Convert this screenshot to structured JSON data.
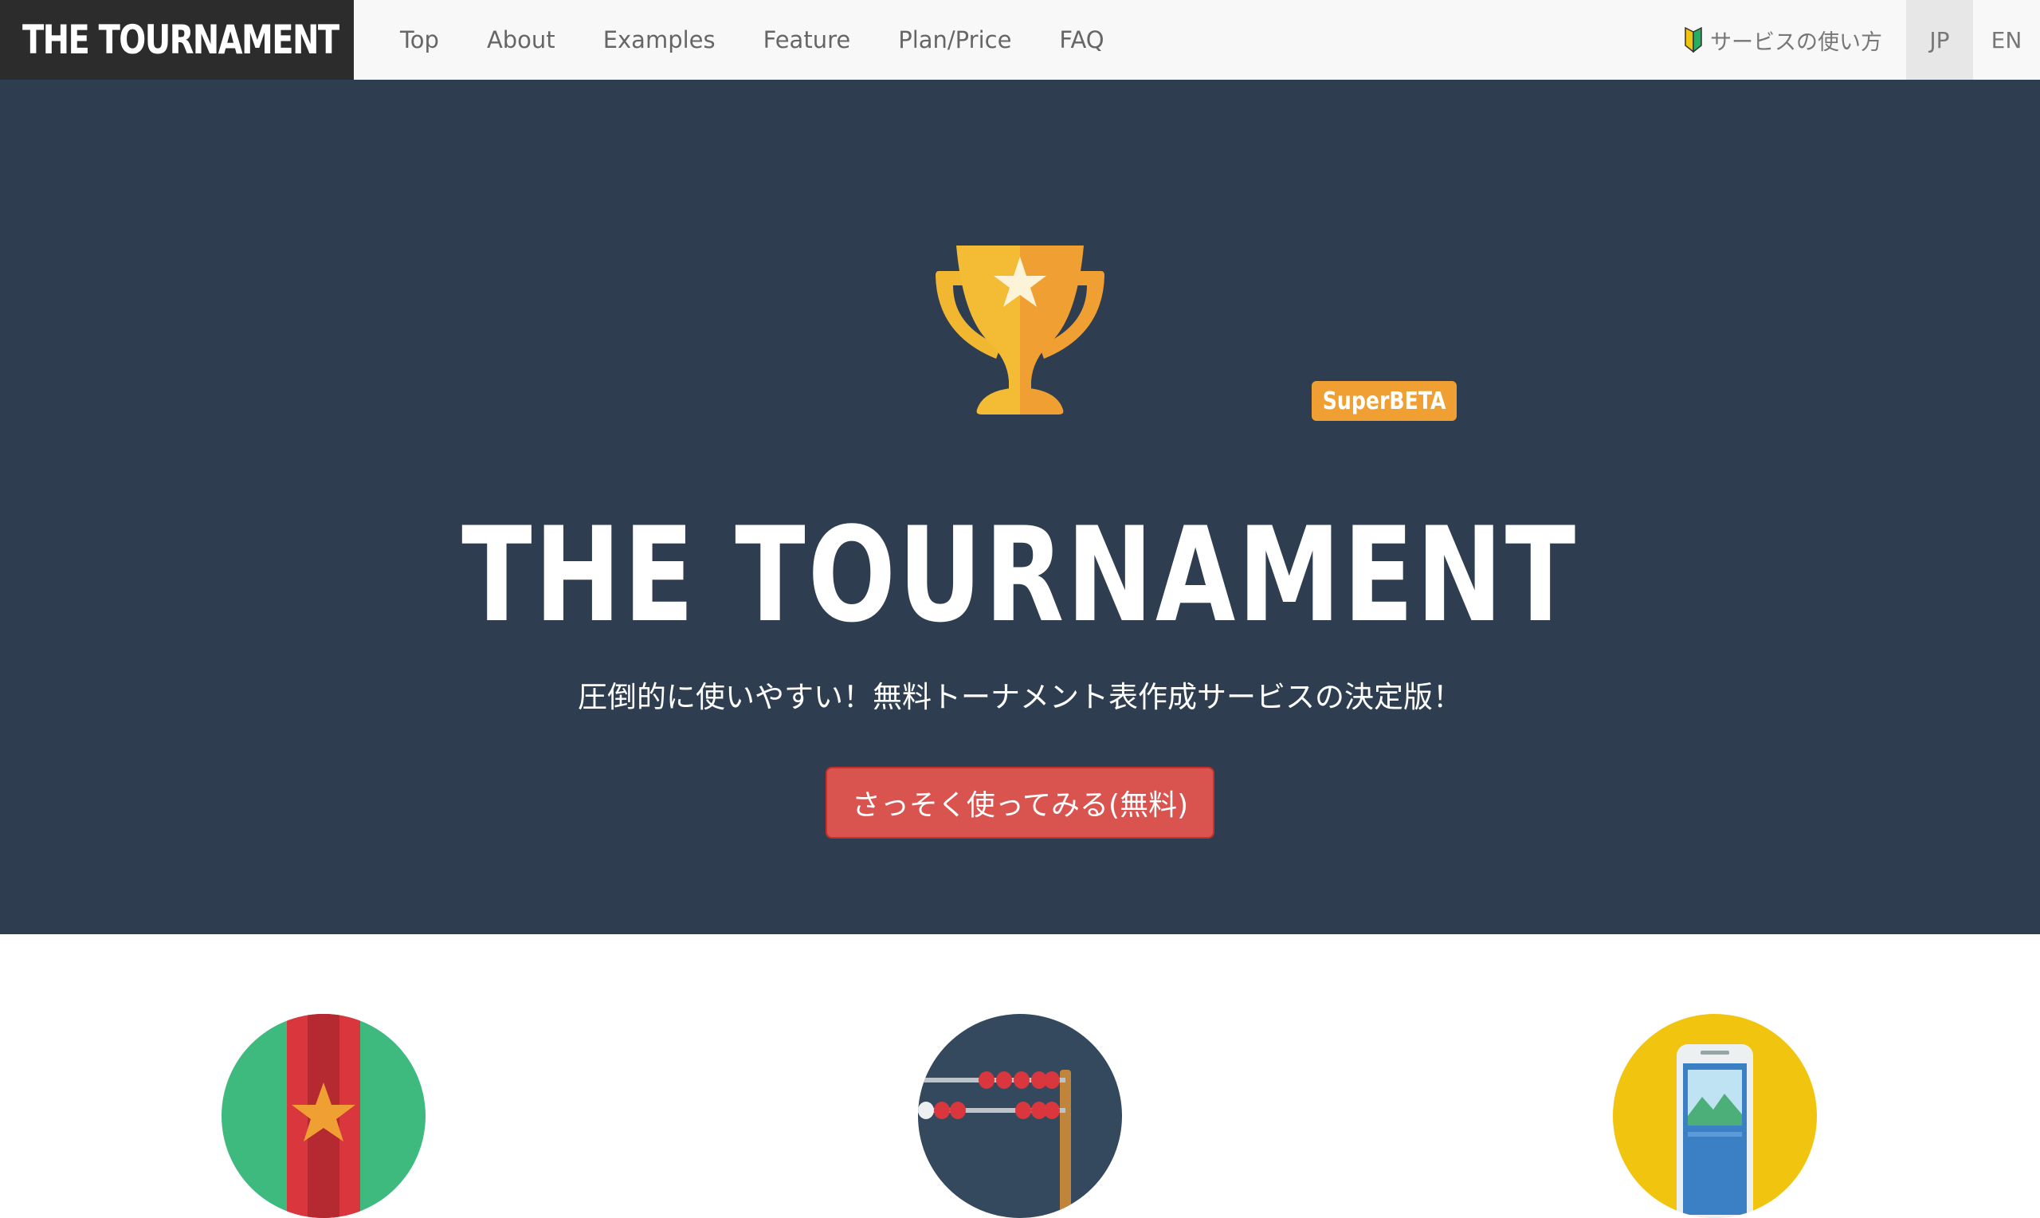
{
  "navbar": {
    "brand": "THE TOURNAMENT",
    "links": [
      "Top",
      "About",
      "Examples",
      "Feature",
      "Plan/Price",
      "FAQ"
    ],
    "howto_label": "サービスの使い方",
    "howto_icon": "beginner-mark-icon",
    "languages": [
      {
        "label": "JP",
        "active": true
      },
      {
        "label": "EN",
        "active": false
      }
    ]
  },
  "hero": {
    "badge": "SuperBETA",
    "title": "THE TOURNAMENT",
    "subtitle": "圧倒的に使いやすい！無料トーナメント表作成サービスの決定版！",
    "cta_label": "さっそく使ってみる(無料)",
    "trophy_icon": "trophy-icon"
  },
  "features": [
    {
      "icon": "medal-icon",
      "color": "#3fba7f"
    },
    {
      "icon": "abacus-icon",
      "color": "#34495e"
    },
    {
      "icon": "smartphone-icon",
      "color": "#f1c40f"
    }
  ],
  "colors": {
    "hero_bg": "#2e3e50",
    "brand_bg": "#2c2c2c",
    "cta": "#d9534f",
    "badge": "#f0a032"
  }
}
